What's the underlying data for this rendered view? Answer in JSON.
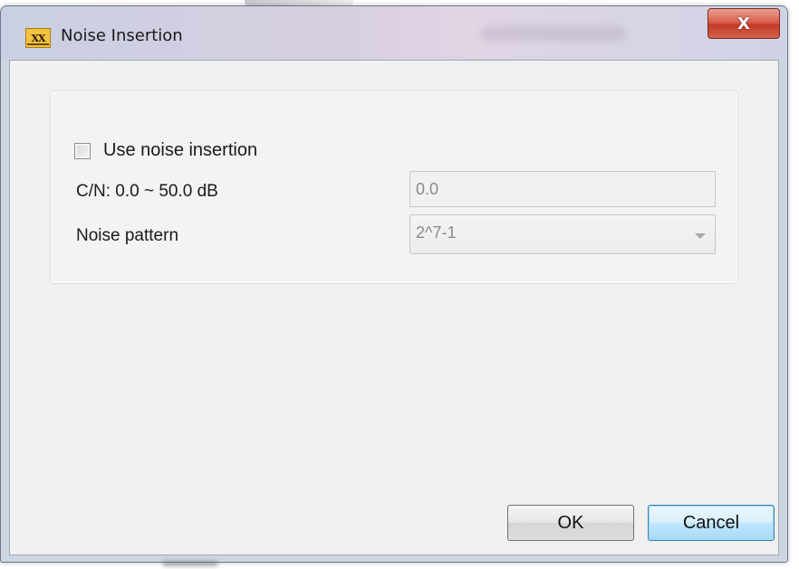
{
  "window": {
    "title": "Noise Insertion",
    "app_icon_text": "XX",
    "close_glyph": "X"
  },
  "form": {
    "use_noise_label": "Use noise insertion",
    "use_noise_checked": false,
    "cn_label": "C/N: 0.0 ~ 50.0 dB",
    "cn_value": "0.0",
    "pattern_label": "Noise pattern",
    "pattern_value": "2^7-1"
  },
  "buttons": {
    "ok": "OK",
    "cancel": "Cancel"
  },
  "icons": {
    "app": "app-logo-icon",
    "close": "close-icon",
    "dropdown": "chevron-down-icon"
  },
  "colors": {
    "close_button": "#c33a27",
    "default_button_border": "#3c7fb1",
    "disabled_text": "#8a8a8a"
  }
}
